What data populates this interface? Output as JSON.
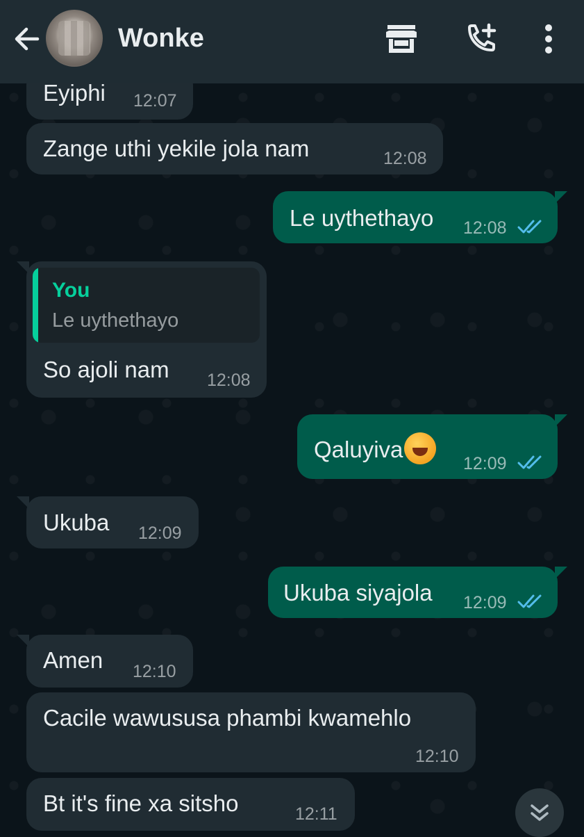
{
  "header": {
    "contact_name": "Wonke",
    "back_icon": "arrow-left-icon",
    "shop_icon": "store-icon",
    "call_icon": "add-call-icon",
    "menu_icon": "more-vertical-icon"
  },
  "messages": [
    {
      "direction": "in",
      "text": "Eyiphi",
      "time": "12:07"
    },
    {
      "direction": "in",
      "text": "Zange  uthi yekile  jola  nam",
      "time": "12:08"
    },
    {
      "direction": "out",
      "text": "Le uythethayo",
      "time": "12:08",
      "status": "read"
    },
    {
      "direction": "in",
      "quote_author": "You",
      "quote_text": "Le uythethayo",
      "text": "So ajoli nam",
      "time": "12:08"
    },
    {
      "direction": "out",
      "text": "Qaluyiva",
      "emoji": "rolling-on-floor-laughing-emoji",
      "time": "12:09",
      "status": "read"
    },
    {
      "direction": "in",
      "text": "Ukuba",
      "time": "12:09"
    },
    {
      "direction": "out",
      "text": "Ukuba siyajola",
      "time": "12:09",
      "status": "read"
    },
    {
      "direction": "in",
      "text": "Amen",
      "time": "12:10"
    },
    {
      "direction": "in",
      "text": "Cacile wawususa phambi kwamehlo",
      "time": "12:10"
    },
    {
      "direction": "in",
      "text": "Bt  it's fine xa sitsho",
      "time": "12:11"
    }
  ],
  "scroll_button_icon": "chevrons-down-icon",
  "colors": {
    "header": "#1f2c33",
    "incoming": "#202c33",
    "outgoing": "#005c4b",
    "accent": "#06cf9c",
    "read_ticks": "#53bdeb"
  }
}
